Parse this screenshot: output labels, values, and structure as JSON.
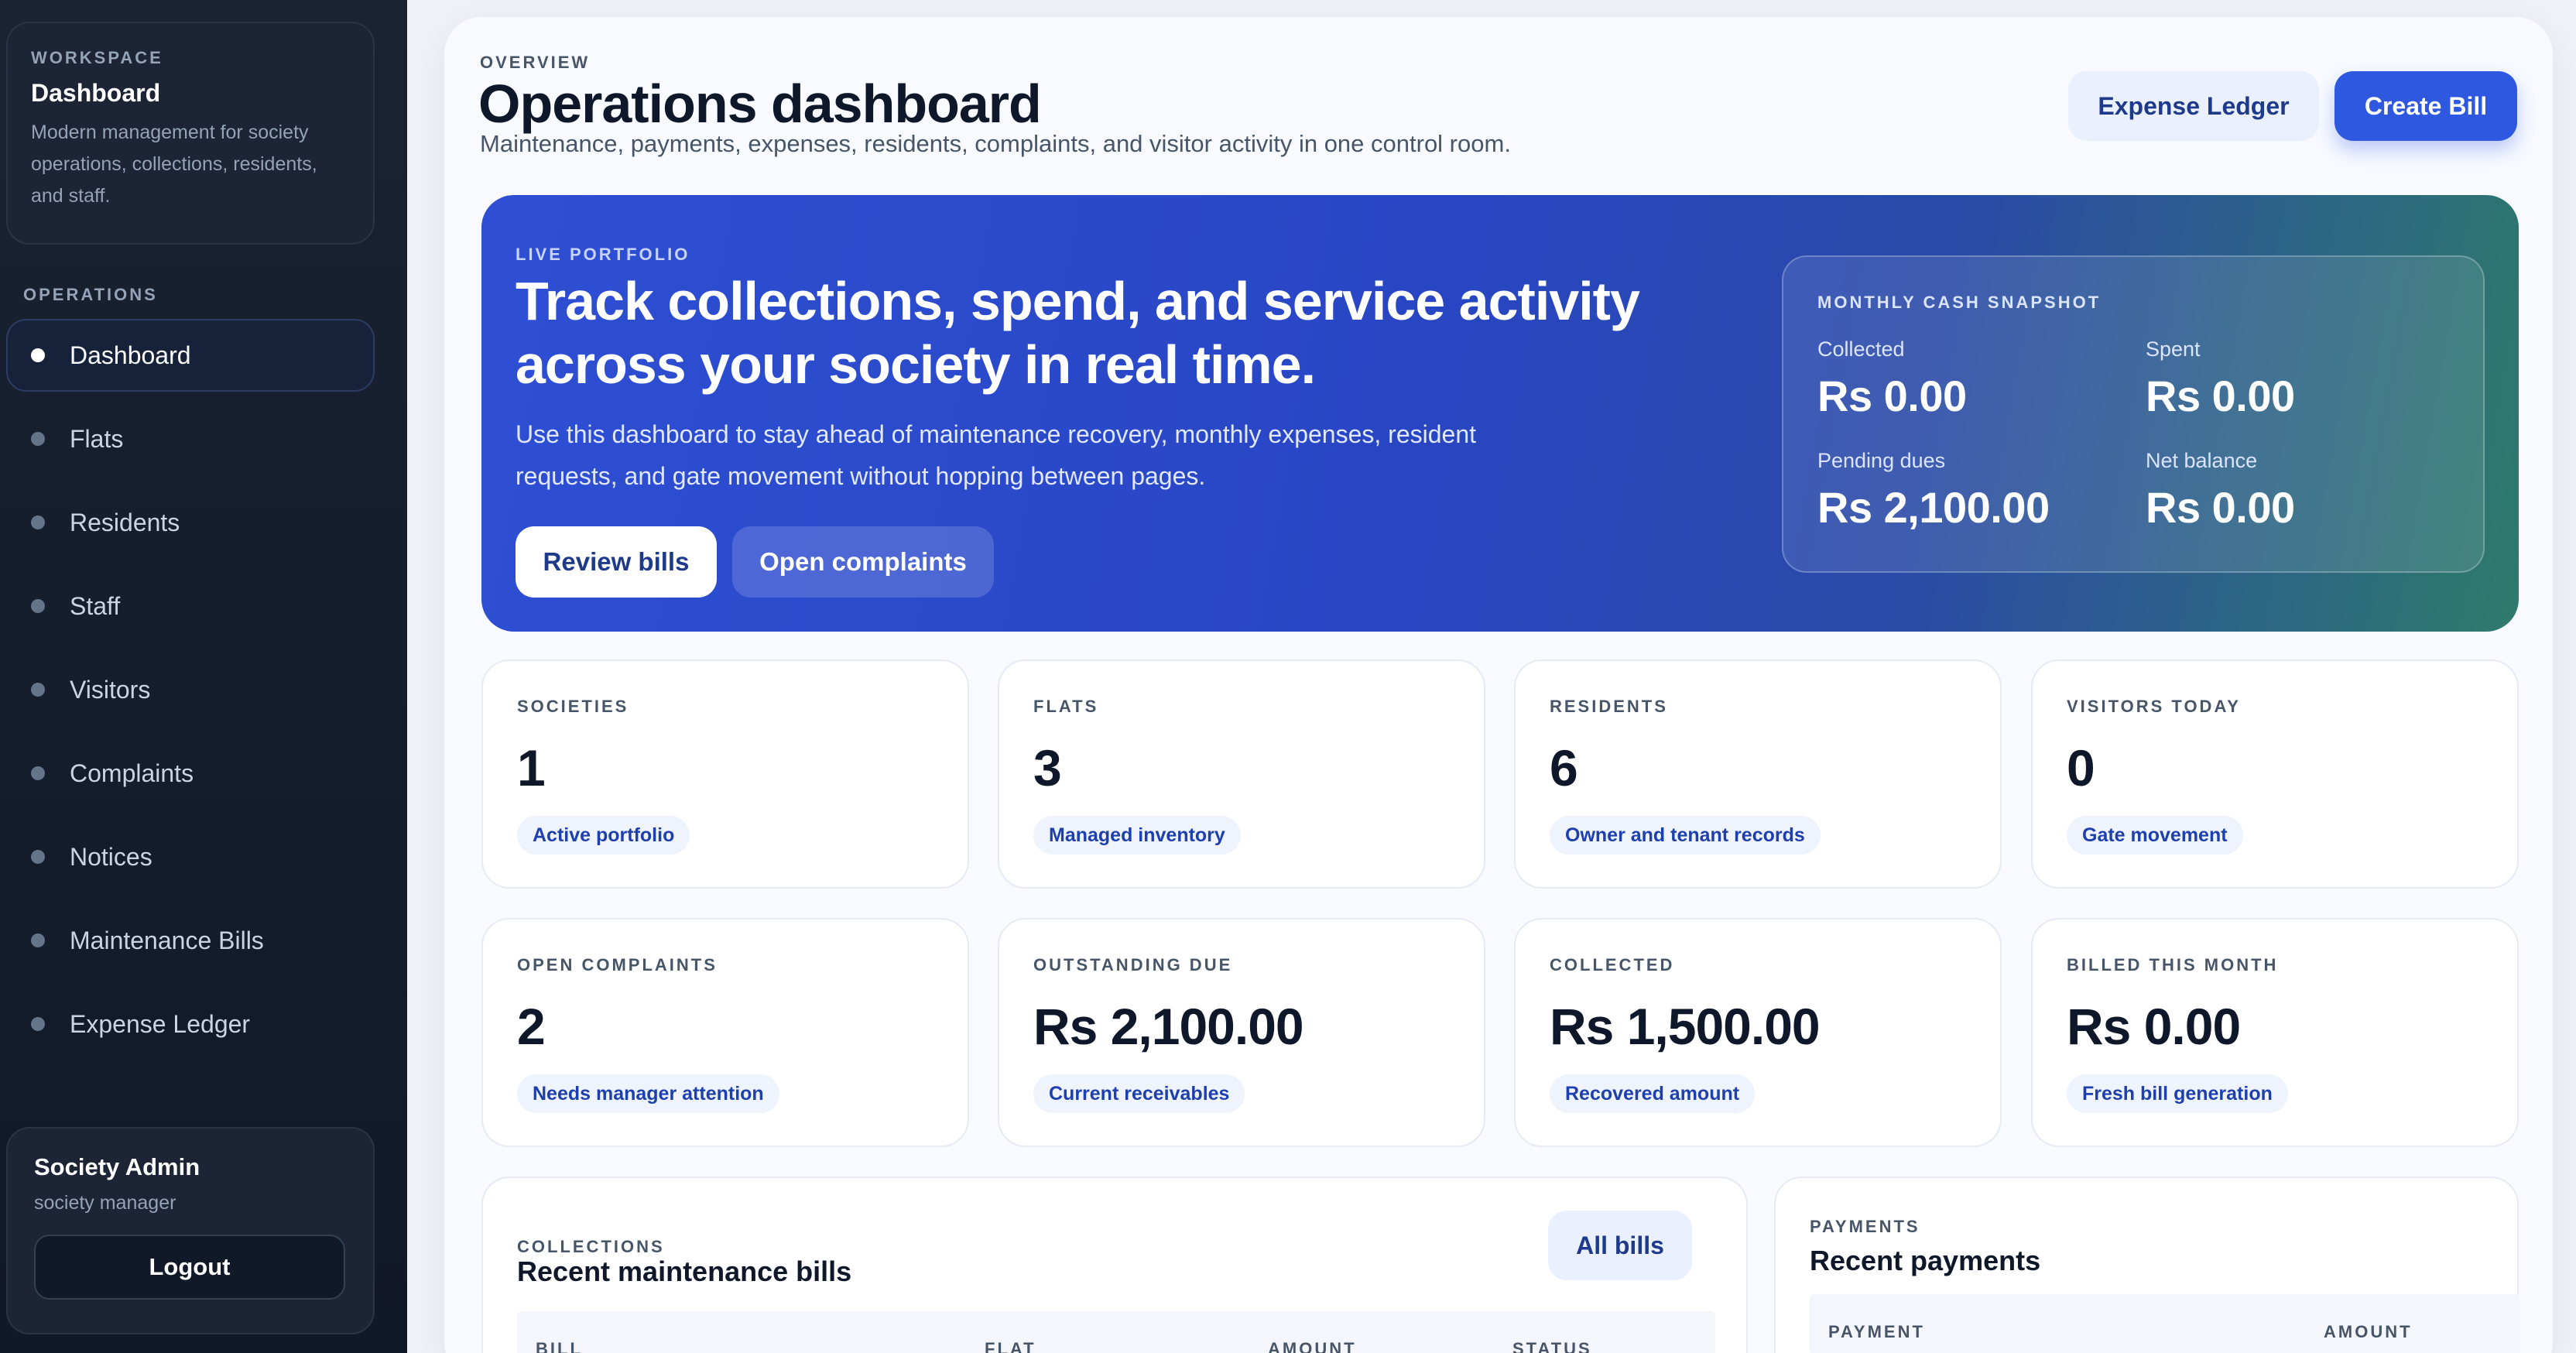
{
  "sidebar": {
    "workspace": {
      "eyebrow": "WORKSPACE",
      "title": "Dashboard",
      "description": "Modern management for society operations, collections, residents, and staff."
    },
    "section_heading": "OPERATIONS",
    "items": [
      {
        "label": "Dashboard",
        "active": true
      },
      {
        "label": "Flats"
      },
      {
        "label": "Residents"
      },
      {
        "label": "Staff"
      },
      {
        "label": "Visitors"
      },
      {
        "label": "Complaints"
      },
      {
        "label": "Notices"
      },
      {
        "label": "Maintenance Bills"
      },
      {
        "label": "Expense Ledger"
      }
    ],
    "user": {
      "name": "Society Admin",
      "role": "society manager",
      "logout_label": "Logout"
    }
  },
  "header": {
    "eyebrow": "OVERVIEW",
    "title": "Operations dashboard",
    "subtitle": "Maintenance, payments, expenses, residents, complaints, and visitor activity in one control room.",
    "expense_ledger_label": "Expense Ledger",
    "create_bill_label": "Create Bill"
  },
  "hero": {
    "eyebrow": "LIVE PORTFOLIO",
    "title": "Track collections, spend, and service activity across your society in real time.",
    "description": "Use this dashboard to stay ahead of maintenance recovery, monthly expenses, resident requests, and gate movement without hopping between pages.",
    "review_bills_label": "Review bills",
    "open_complaints_label": "Open complaints",
    "snapshot": {
      "eyebrow": "MONTHLY CASH SNAPSHOT",
      "collected_label": "Collected",
      "collected_value": "Rs 0.00",
      "spent_label": "Spent",
      "spent_value": "Rs 0.00",
      "pending_label": "Pending dues",
      "pending_value": "Rs 2,100.00",
      "net_label": "Net balance",
      "net_value": "Rs 0.00"
    }
  },
  "stats": [
    {
      "label": "SOCIETIES",
      "value": "1",
      "chip": "Active portfolio"
    },
    {
      "label": "FLATS",
      "value": "3",
      "chip": "Managed inventory"
    },
    {
      "label": "RESIDENTS",
      "value": "6",
      "chip": "Owner and tenant records"
    },
    {
      "label": "VISITORS TODAY",
      "value": "0",
      "chip": "Gate movement"
    },
    {
      "label": "OPEN COMPLAINTS",
      "value": "2",
      "chip": "Needs manager attention"
    },
    {
      "label": "OUTSTANDING DUE",
      "value": "Rs 2,100.00",
      "chip": "Current receivables"
    },
    {
      "label": "COLLECTED",
      "value": "Rs 1,500.00",
      "chip": "Recovered amount"
    },
    {
      "label": "BILLED THIS MONTH",
      "value": "Rs 0.00",
      "chip": "Fresh bill generation"
    }
  ],
  "bills_panel": {
    "eyebrow": "COLLECTIONS",
    "title": "Recent maintenance bills",
    "all_bills_label": "All bills",
    "columns": [
      "BILL",
      "FLAT",
      "AMOUNT",
      "STATUS"
    ]
  },
  "payments_panel": {
    "eyebrow": "PAYMENTS",
    "title": "Recent payments",
    "columns": [
      "PAYMENT",
      "AMOUNT"
    ]
  },
  "colors": {
    "sidebar_bg": "#111827",
    "accent": "#2f58e0",
    "hero_start": "#2e4fd4",
    "hero_end": "#2f7a6b",
    "chip_bg": "#eef3fc",
    "chip_text": "#1e40af"
  }
}
